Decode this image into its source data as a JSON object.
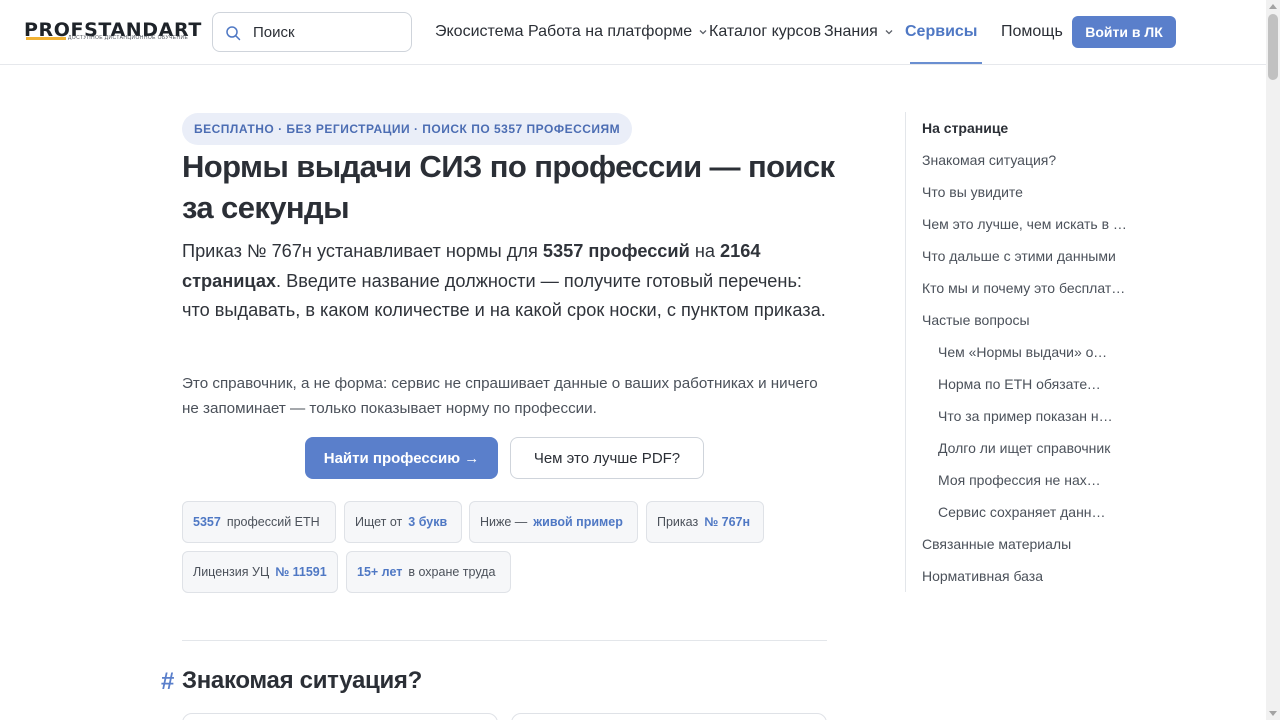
{
  "header": {
    "logo_text": "PROFSTANDART",
    "logo_tagline": "ДОСТУПНОЕ ДИСТАНЦИОННОЕ ОБУЧЕНИЕ",
    "search_placeholder": "Поиск",
    "nav": [
      {
        "label": "Экосистема",
        "dropdown": false
      },
      {
        "label": "Работа на платформе",
        "dropdown": true
      },
      {
        "label": "Каталог курсов",
        "dropdown": false
      },
      {
        "label": "Знания",
        "dropdown": true
      },
      {
        "label": "Сервисы",
        "dropdown": true,
        "active": true
      },
      {
        "label": "Помощь",
        "dropdown": false
      }
    ],
    "login_label": "Войти в ЛК"
  },
  "hero": {
    "badge": "БЕСПЛАТНО · БЕЗ РЕГИСТРАЦИИ · ПОИСК ПО 5357 ПРОФЕССИЯМ",
    "title": "Нормы выдачи СИЗ по профессии — поиск за секунды",
    "lead_1": "Приказ № 767н устанавливает нормы для ",
    "lead_b1": "5357 профессий",
    "lead_2": " на ",
    "lead_b2": "2164 страницах",
    "lead_3": ". Введите название должности — получите готовый перечень: что выдавать, в каком количестве и на какой срок носки, с пунктом приказа.",
    "note": "Это справочник, а не форма: сервис не спрашивает данные о ваших работниках и ничего не запоминает — только показывает норму по профессии.",
    "primary_button": "Найти профессию →",
    "secondary_button": "Чем это лучше PDF?"
  },
  "chips": [
    {
      "accent": "5357",
      "text": "профессий ЕТН",
      "accent_first": true
    },
    {
      "accent": "3 букв",
      "text": "Ищет от",
      "accent_first": false
    },
    {
      "accent": "живой пример",
      "text": "Ниже —",
      "accent_first": false
    },
    {
      "accent": "№ 767н",
      "text": "Приказ",
      "accent_first": false
    },
    {
      "accent": "№ 11591",
      "text": "Лицензия УЦ",
      "accent_first": false
    },
    {
      "accent": "15+ лет",
      "text": "в охране труда",
      "accent_first": true
    }
  ],
  "section": {
    "hash": "#",
    "title": "Знакомая ситуация?"
  },
  "toc": {
    "title": "На странице",
    "items": [
      {
        "label": "Знакомая ситуация?",
        "level": 1
      },
      {
        "label": "Что вы увидите",
        "level": 1
      },
      {
        "label": "Чем это лучше, чем искать в PDF",
        "level": 1
      },
      {
        "label": "Что дальше с этими данными",
        "level": 1
      },
      {
        "label": "Кто мы и почему это бесплатно",
        "level": 1
      },
      {
        "label": "Частые вопросы",
        "level": 1
      },
      {
        "label": "Чем «Нормы выдачи» отличаются",
        "level": 2
      },
      {
        "label": "Норма по ЕТН обязательна",
        "level": 2
      },
      {
        "label": "Что за пример показан ниже",
        "level": 2
      },
      {
        "label": "Долго ли ищет справочник",
        "level": 2
      },
      {
        "label": "Моя профессия не находится",
        "level": 2
      },
      {
        "label": "Сервис сохраняет данные",
        "level": 2
      },
      {
        "label": "Связанные материалы",
        "level": 1
      },
      {
        "label": "Нормативная база",
        "level": 1
      }
    ]
  },
  "colors": {
    "accent": "#5a7fcb",
    "accent_text": "#4f78c4",
    "logo_bar": "#f2b233"
  }
}
